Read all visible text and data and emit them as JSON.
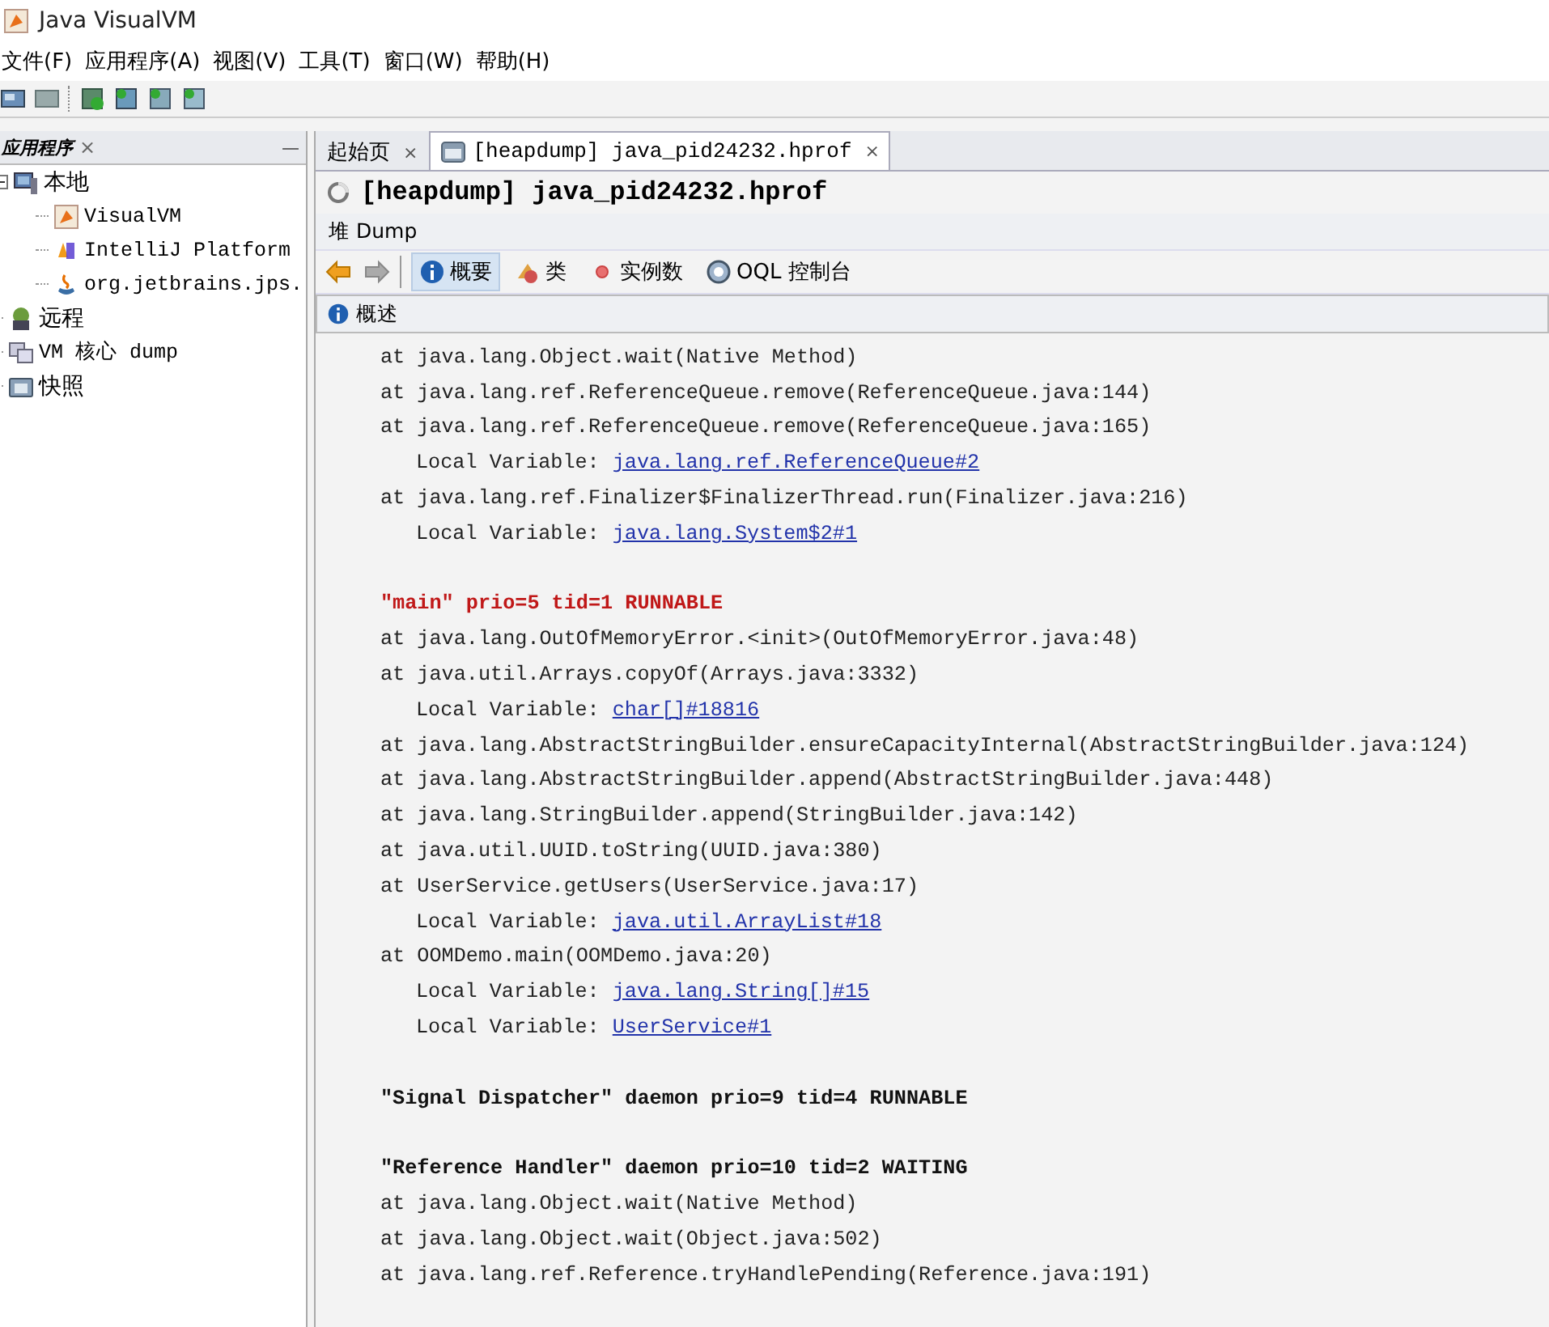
{
  "window": {
    "title": "Java VisualVM"
  },
  "menu": [
    "文件(F)",
    "应用程序(A)",
    "视图(V)",
    "工具(T)",
    "窗口(W)",
    "帮助(H)"
  ],
  "sidebar": {
    "title": "应用程序",
    "close": "×",
    "minimize": "—",
    "items": [
      {
        "label": "本地",
        "expanded": true,
        "children": [
          {
            "label": "VisualVM"
          },
          {
            "label": "IntelliJ Platform"
          },
          {
            "label": "org.jetbrains.jps."
          }
        ]
      },
      {
        "label": "远程"
      },
      {
        "label": "VM 核心 dump"
      },
      {
        "label": "快照"
      }
    ]
  },
  "tabs": [
    {
      "label": "起始页",
      "close": "×",
      "selected": false
    },
    {
      "label": "[heapdump] java_pid24232.hprof",
      "close": "×",
      "selected": true
    }
  ],
  "document": {
    "title": "[heapdump] java_pid24232.hprof",
    "section": "堆 Dump",
    "views": [
      {
        "label": "概要",
        "selected": true
      },
      {
        "label": "类",
        "selected": false
      },
      {
        "label": "实例数",
        "selected": false
      },
      {
        "label": "OQL 控制台",
        "selected": false
      }
    ],
    "panel_title": "概述",
    "lines": [
      {
        "kind": "frame",
        "text": "at java.lang.Object.wait(Native Method)"
      },
      {
        "kind": "frame",
        "text": "at java.lang.ref.ReferenceQueue.remove(ReferenceQueue.java:144)"
      },
      {
        "kind": "frame",
        "text": "at java.lang.ref.ReferenceQueue.remove(ReferenceQueue.java:165)"
      },
      {
        "kind": "local",
        "text": "Local Variable:",
        "link": "java.lang.ref.ReferenceQueue#2"
      },
      {
        "kind": "frame",
        "text": "at java.lang.ref.Finalizer$FinalizerThread.run(Finalizer.java:216)"
      },
      {
        "kind": "local",
        "text": "Local Variable:",
        "link": "java.lang.System$2#1"
      },
      {
        "kind": "blank"
      },
      {
        "kind": "thread",
        "text": "\"main\" prio=5 tid=1 RUNNABLE",
        "highlighted": true
      },
      {
        "kind": "frame",
        "text": "at java.lang.OutOfMemoryError.<init>(OutOfMemoryError.java:48)"
      },
      {
        "kind": "frame",
        "text": "at java.util.Arrays.copyOf(Arrays.java:3332)"
      },
      {
        "kind": "local",
        "text": "Local Variable:",
        "link": "char[]#18816"
      },
      {
        "kind": "frame",
        "text": "at java.lang.AbstractStringBuilder.ensureCapacityInternal(AbstractStringBuilder.java:124)"
      },
      {
        "kind": "frame",
        "text": "at java.lang.AbstractStringBuilder.append(AbstractStringBuilder.java:448)"
      },
      {
        "kind": "frame",
        "text": "at java.lang.StringBuilder.append(StringBuilder.java:142)"
      },
      {
        "kind": "frame",
        "text": "at java.util.UUID.toString(UUID.java:380)"
      },
      {
        "kind": "frame",
        "text": "at UserService.getUsers(UserService.java:17)"
      },
      {
        "kind": "local",
        "text": "Local Variable:",
        "link": "java.util.ArrayList#18"
      },
      {
        "kind": "frame",
        "text": "at OOMDemo.main(OOMDemo.java:20)"
      },
      {
        "kind": "local",
        "text": "Local Variable:",
        "link": "java.lang.String[]#15"
      },
      {
        "kind": "local",
        "text": "Local Variable:",
        "link": "UserService#1"
      },
      {
        "kind": "blank"
      },
      {
        "kind": "thread",
        "text": "\"Signal Dispatcher\" daemon prio=9 tid=4 RUNNABLE",
        "highlighted": false
      },
      {
        "kind": "blank"
      },
      {
        "kind": "thread",
        "text": "\"Reference Handler\" daemon prio=10 tid=2 WAITING",
        "highlighted": false
      },
      {
        "kind": "frame",
        "text": "at java.lang.Object.wait(Native Method)"
      },
      {
        "kind": "frame",
        "text": "at java.lang.Object.wait(Object.java:502)"
      },
      {
        "kind": "frame",
        "text": "at java.lang.ref.Reference.tryHandlePending(Reference.java:191)"
      }
    ]
  }
}
